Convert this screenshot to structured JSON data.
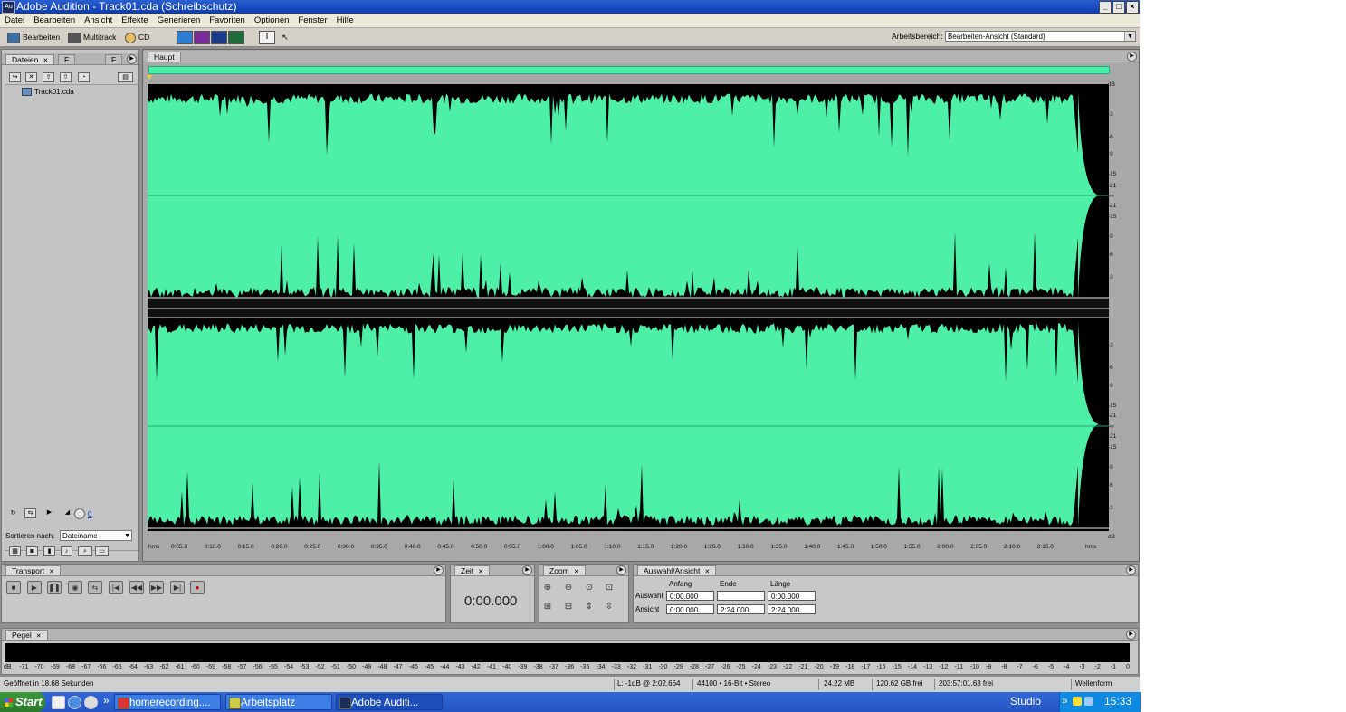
{
  "window": {
    "title": "Adobe Audition - Track01.cda (Schreibschutz)",
    "app_icon": "Au",
    "min": "_",
    "max": "□",
    "close": "×"
  },
  "menu": [
    "Datei",
    "Bearbeiten",
    "Ansicht",
    "Effekte",
    "Generieren",
    "Favoriten",
    "Optionen",
    "Fenster",
    "Hilfe"
  ],
  "toolbar": {
    "edit_view": "Bearbeiten",
    "multitrack": "Multitrack",
    "cd": "CD",
    "workspace_label": "Arbeitsbereich:",
    "workspace_value": "Bearbeiten-Ansicht (Standard)"
  },
  "files_panel": {
    "tabs": [
      "Dateien",
      "Effekte",
      "F"
    ],
    "file": "Track01.cda",
    "sort_label": "Sortieren nach:",
    "sort_value": "Dateiname",
    "volume_value": "0"
  },
  "editor": {
    "tab": "Haupt",
    "db_label_top": "dB",
    "db_label_bottom": "dB",
    "db_ticks": [
      "-3",
      "-6",
      "-9",
      "-15",
      "-21",
      "-∞",
      "-21",
      "-15",
      "-9",
      "-6",
      "-3"
    ],
    "time_unit": "hms",
    "time_ticks": [
      "0:05.0",
      "0:10.0",
      "0:15.0",
      "0:20.0",
      "0:25.0",
      "0:30.0",
      "0:35.0",
      "0:40.0",
      "0:45.0",
      "0:50.0",
      "0:55.0",
      "1:00.0",
      "1:05.0",
      "1:10.0",
      "1:15.0",
      "1:20.0",
      "1:25.0",
      "1:30.0",
      "1:35.0",
      "1:40.0",
      "1:45.0",
      "1:50.0",
      "1:55.0",
      "2:00.0",
      "2:05.0",
      "2:10.0",
      "2:15.0"
    ],
    "waveform_color": "#4ef0a8"
  },
  "transport": {
    "tab": "Transport"
  },
  "time": {
    "tab": "Zeit",
    "value": "0:00.000"
  },
  "zoom": {
    "tab": "Zoom"
  },
  "selection": {
    "tab": "Auswahl/Ansicht",
    "col_start": "Anfang",
    "col_end": "Ende",
    "col_length": "Länge",
    "row_selection": "Auswahl",
    "row_view": "Ansicht",
    "sel_start": "0:00.000",
    "sel_end": "",
    "sel_length": "0:00.000",
    "view_start": "0:00.000",
    "view_end": "2:24.000",
    "view_length": "2:24.000"
  },
  "levels": {
    "tab": "Pegel",
    "scale": [
      "dB",
      "-71",
      "-70",
      "-69",
      "-68",
      "-67",
      "-66",
      "-65",
      "-64",
      "-63",
      "-62",
      "-61",
      "-60",
      "-59",
      "-58",
      "-57",
      "-56",
      "-55",
      "-54",
      "-53",
      "-52",
      "-51",
      "-50",
      "-49",
      "-48",
      "-47",
      "-46",
      "-45",
      "-44",
      "-43",
      "-42",
      "-41",
      "-40",
      "-39",
      "-38",
      "-37",
      "-36",
      "-35",
      "-34",
      "-33",
      "-32",
      "-31",
      "-30",
      "-29",
      "-28",
      "-27",
      "-26",
      "-25",
      "-24",
      "-23",
      "-22",
      "-21",
      "-20",
      "-19",
      "-18",
      "-17",
      "-16",
      "-15",
      "-14",
      "-13",
      "-12",
      "-11",
      "-10",
      "-9",
      "-8",
      "-7",
      "-6",
      "-5",
      "-4",
      "-3",
      "-2",
      "-1",
      "0"
    ]
  },
  "status": {
    "opened": "Geöffnet in 18.68 Sekunden",
    "level": "L: -1dB @   2:02.664",
    "format": "44100 • 16-Bit • Stereo",
    "size": "24.22 MB",
    "free": "120.62 GB frei",
    "free_time": "203:57:01.63 frei",
    "view_mode": "Wellenform"
  },
  "taskbar": {
    "start": "Start",
    "chevron": "»",
    "tasks": [
      "homerecording....",
      "Arbeitsplatz",
      "Adobe Auditi..."
    ],
    "studio": "Studio",
    "clock": "15:33"
  }
}
